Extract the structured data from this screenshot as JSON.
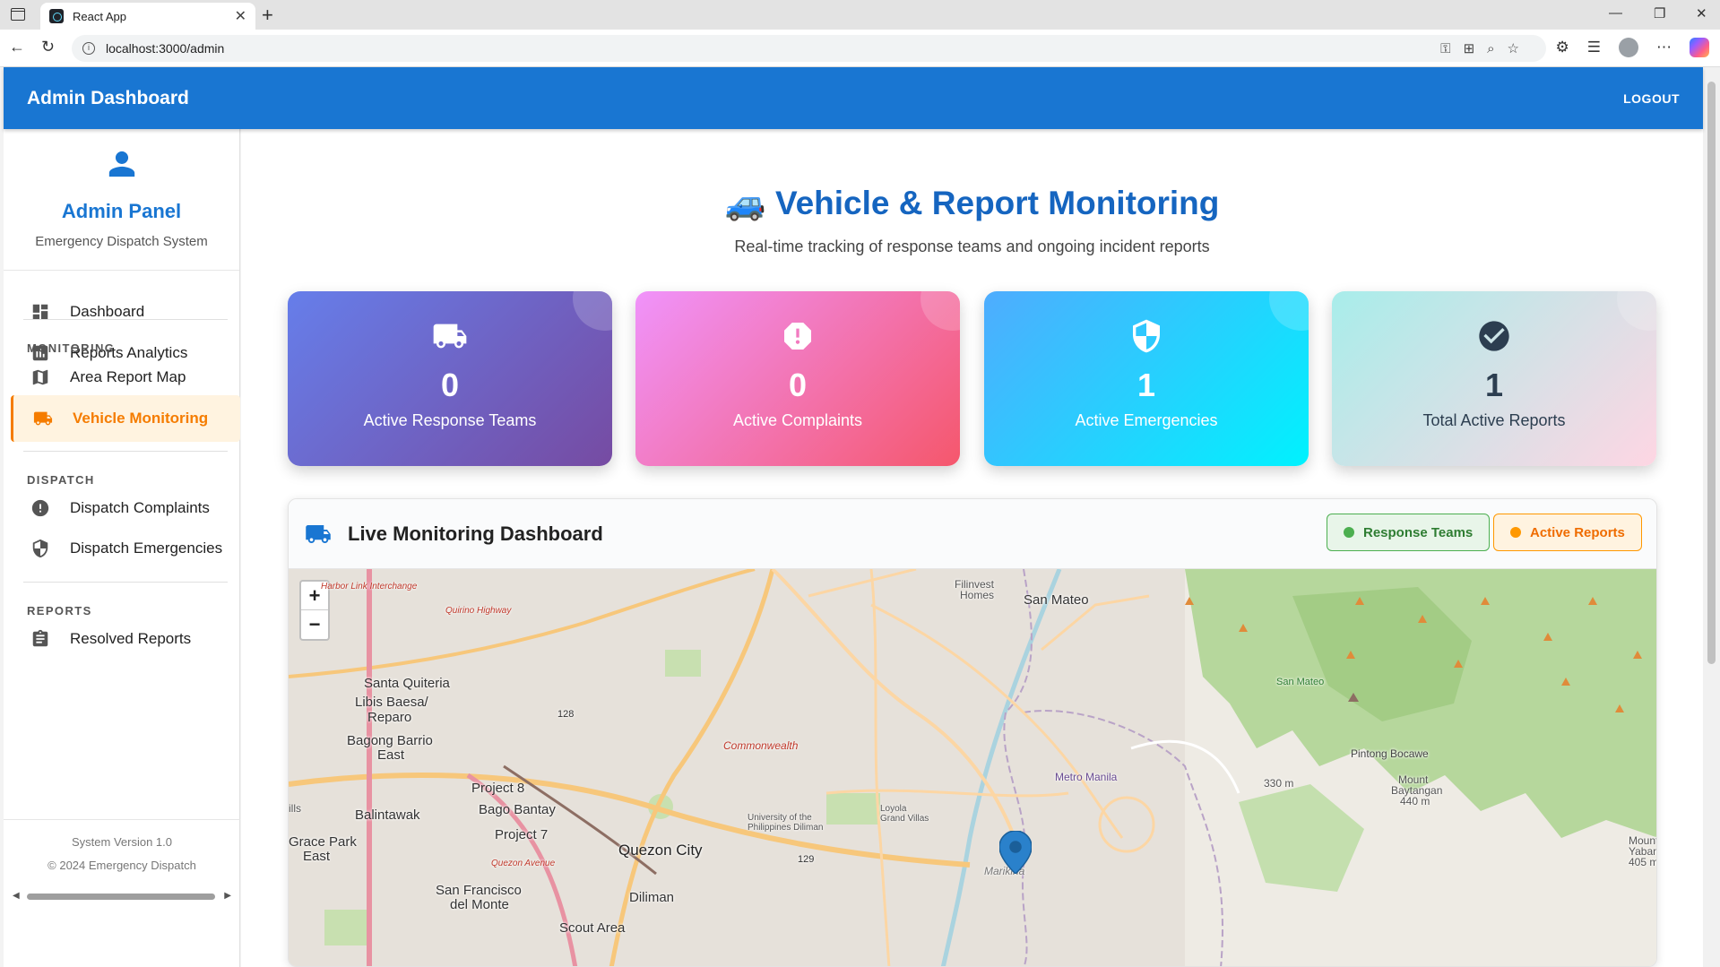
{
  "browser": {
    "tab_title": "React App",
    "url": "localhost:3000/admin"
  },
  "header": {
    "title": "Admin Dashboard",
    "logout_label": "LOGOUT"
  },
  "sidebar": {
    "title": "Admin Panel",
    "subtitle": "Emergency Dispatch System",
    "items": [
      {
        "label": "Dashboard",
        "icon": "dashboard-icon"
      },
      {
        "label": "Reports Analytics",
        "icon": "analytics-icon"
      }
    ],
    "sections": [
      {
        "label": "MONITORING",
        "items": [
          {
            "label": "Area Report Map",
            "icon": "map-icon"
          },
          {
            "label": "Vehicle Monitoring",
            "icon": "truck-icon",
            "active": true
          }
        ]
      },
      {
        "label": "DISPATCH",
        "items": [
          {
            "label": "Dispatch Complaints",
            "icon": "alert-icon"
          },
          {
            "label": "Dispatch Emergencies",
            "icon": "shield-icon"
          }
        ]
      },
      {
        "label": "REPORTS",
        "items": [
          {
            "label": "Resolved Reports",
            "icon": "clipboard-icon"
          }
        ]
      }
    ],
    "version": "System Version 1.0",
    "copyright": "© 2024 Emergency Dispatch"
  },
  "main": {
    "title": "🚙 Vehicle & Report Monitoring",
    "subtitle": "Real-time tracking of response teams and ongoing incident reports",
    "stats": [
      {
        "value": "0",
        "label": "Active Response Teams",
        "icon": "truck-icon"
      },
      {
        "value": "0",
        "label": "Active Complaints",
        "icon": "alert-icon"
      },
      {
        "value": "1",
        "label": "Active Emergencies",
        "icon": "shield-icon"
      },
      {
        "value": "1",
        "label": "Total Active Reports",
        "icon": "check-circle-icon"
      }
    ],
    "monitor": {
      "title": "Live Monitoring Dashboard",
      "legend_teams": "Response Teams",
      "legend_reports": "Active Reports",
      "zoom_in": "+",
      "zoom_out": "−"
    },
    "map_labels": {
      "san_mateo": "San Mateo",
      "santa_quiteria": "Santa Quiteria",
      "libis_baesa": "Libis Baesa/",
      "reparo": "Reparo",
      "bagong_barrio": "Bagong Barrio",
      "east": "East",
      "project8": "Project 8",
      "bago_bantay": "Bago Bantay",
      "project7": "Project 7",
      "balintawak": "Balintawak",
      "quezon_city": "Quezon City",
      "san_francisco": "San Francisco",
      "del_monte": "del Monte",
      "diliman": "Diliman",
      "scout_area": "Scout Area",
      "grace_park": "Grace Park",
      "grace_park_east": "East",
      "marikina": "Marikina",
      "pintong_bocawe": "Pintong Bocawe",
      "mount_baytangan": "Mount",
      "baytangan": "Baytangan",
      "baytangan_elev": "440 m",
      "mount_yabang": "Mount",
      "yabang": "Yabang",
      "yabang_elev": "405 m",
      "elev_330": "330 m",
      "commonwealth": "Commonwealth",
      "metro_manila": "Metro Manila",
      "filinvest": "Filinvest",
      "homes": "Homes",
      "up_diliman": "University of the Philippines Diliman",
      "loyola": "Loyola Grand Villas",
      "route_128": "128",
      "route_129": "129",
      "harbor_link": "Harbor Link Interchange",
      "quirino": "Quirino Highway",
      "quezon_ave": "Quezon Avenue",
      "san_mateo_green": "San Mateo",
      "ills": "ills"
    }
  }
}
